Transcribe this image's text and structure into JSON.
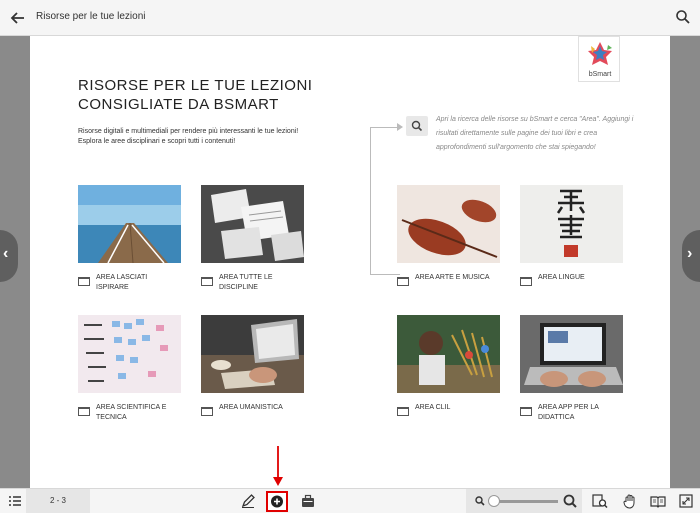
{
  "header": {
    "title": "Risorse per le tue lezioni"
  },
  "page": {
    "logo_text": "bSmart",
    "heading_line1": "RISORSE PER LE TUE LEZIONI",
    "heading_line2": "CONSIGLIATE DA BSMART",
    "intro": "Risorse digitali e multimediali per rendere più interessanti le tue lezioni!  Esplora le aree disciplinari e scopri tutti i contenuti!",
    "search_hint": "Apri la ricerca delle risorse su bSmart e cerca \"Area\". Aggiungi i risultati direttamente sulle pagine dei tuoi libri e crea approfondimenti sull'argomento che stai spiegando!",
    "tiles": [
      {
        "label": "AREA LASCIATI ISPIRARE"
      },
      {
        "label": "AREA TUTTE LE DISCIPLINE"
      },
      {
        "label": "AREA ARTE E MUSICA"
      },
      {
        "label": "AREA LINGUE"
      },
      {
        "label": "AREA SCIENTIFICA E TECNICA"
      },
      {
        "label": "AREA UMANISTICA"
      },
      {
        "label": "AREA CLIL"
      },
      {
        "label": "AREA APP PER LA DIDATTICA"
      }
    ]
  },
  "bottombar": {
    "page_indicator": "2 - 3"
  },
  "icons": {
    "back": "arrow-left-icon",
    "search": "search-icon",
    "menu": "list-icon",
    "pen": "pen-icon",
    "add": "plus-circle-icon",
    "briefcase": "briefcase-icon",
    "zoom_out": "zoom-out-icon",
    "zoom_in": "zoom-in-icon",
    "search_page": "search-page-icon",
    "hand": "hand-icon",
    "book": "book-icon",
    "fullscreen": "fullscreen-icon",
    "folder": "folder-icon"
  },
  "colors": {
    "highlight": "#e00000"
  }
}
